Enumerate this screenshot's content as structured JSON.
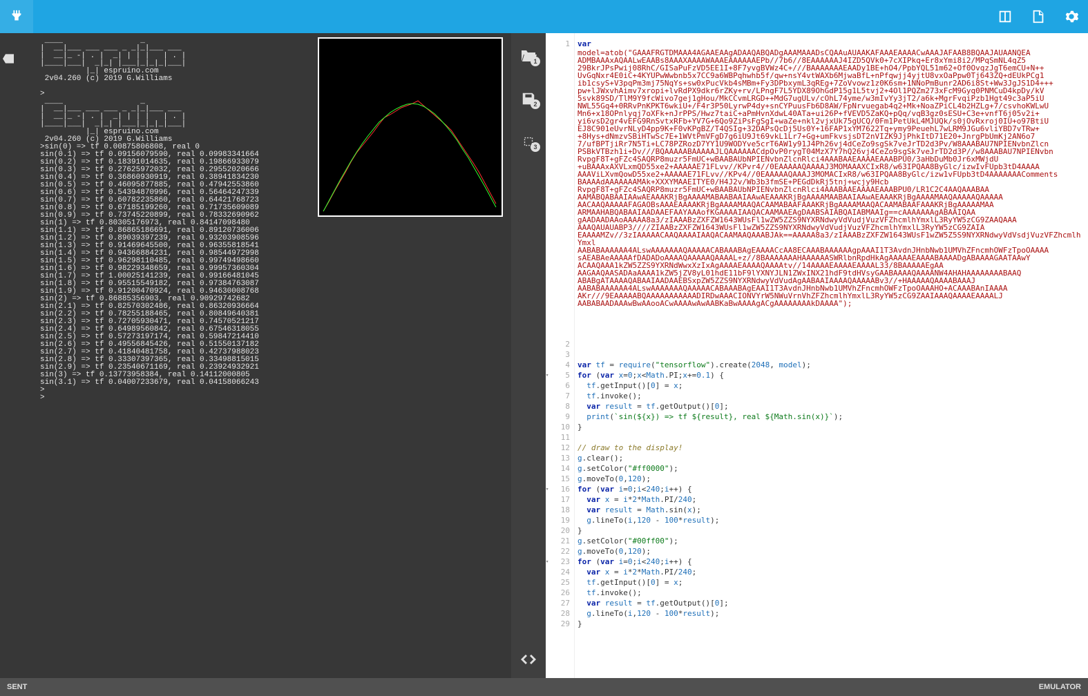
{
  "toolbar": {
    "connect_icon": "plug-icon",
    "layout_icon": "split-icon",
    "book_icon": "book-icon",
    "settings_icon": "gear-icon"
  },
  "left_panel": {
    "close_tab_icon": "close-tab-icon",
    "banner_lines": [
      " ____                 _ ",
      "|  __|___ ___ ___ _ _|_|___ ___ ",
      "|  __|_ -| . |  _| | | |   | . |",
      "|____|___|  _|_| |___|_|_|_|___|",
      "          |_| espruino.com",
      " 2v04.260 (c) 2019 G.Williams",
      "",
      ">",
      " ____                 _ ",
      "|  __|___ ___ ___ _ _|_|___ ___ ",
      "|  __|_ -| . |  _| | | |   | . |",
      "|____|___|  _|_| |___|_|_|_|___|",
      "          |_| espruino.com",
      " 2v04.260 (c) 2019 G.Williams"
    ],
    "output_lines": [
      ">sin(0) => tf 0.00875806808, real 0",
      "sin(0.1) => tf 0.09156079590, real 0.09983341664",
      "sin(0.2) => tf 0.18391014635, real 0.19866933079",
      "sin(0.3) => tf 0.27625972032, real 0.29552020666",
      "sin(0.4) => tf 0.36860930919, real 0.38941834230",
      "sin(0.5) => tf 0.46095877885, real 0.47942553860",
      "sin(0.6) => tf 0.54394870996, real 0.56464247339",
      "sin(0.7) => tf 0.60782235860, real 0.64421768723",
      "sin(0.8) => tf 0.67185199260, real 0.71735609089",
      "sin(0.9) => tf 0.73745220899, real 0.78332690962",
      "sin(1) => tf 0.80305176973, real 0.84147098480",
      "sin(1.1) => tf 0.86865186691, real 0.89120736006",
      "sin(1.2) => tf 0.89039397239, real 0.93203908596",
      "sin(1.3) => tf 0.91469645500, real 0.96355818541",
      "sin(1.4) => tf 0.94366884231, real 0.98544972998",
      "sin(1.5) => tf 0.96298110485, real 0.99749498660",
      "sin(1.6) => tf 0.98229348659, real 0.99957360304",
      "sin(1.7) => tf 1.00025141239, real 0.99166481045",
      "sin(1.8) => tf 0.95515549182, real 0.97384763087",
      "sin(1.9) => tf 0.91200470924, real 0.94630008768",
      "sin(2) => tf 0.86885356903, real 0.90929742682",
      "sin(2.1) => tf 0.82570302486, real 0.86320936664",
      "sin(2.2) => tf 0.78255188465, real 0.80849640381",
      "sin(2.3) => tf 0.72705930471, real 0.74570521217",
      "sin(2.4) => tf 0.64989560842, real 0.67546318055",
      "sin(2.5) => tf 0.57273197174, real 0.59847214410",
      "sin(2.6) => tf 0.49556845426, real 0.51550137182",
      "sin(2.7) => tf 0.41840481758, real 0.42737988023",
      "sin(2.8) => tf 0.33307397365, real 0.33498815015",
      "sin(2.9) => tf 0.23540671169, real 0.23924932921",
      "sin(3) => tf 0.13773958384, real 0.14112000805",
      "sin(3.1) => tf 0.04007233679, real 0.04158066243",
      ">",
      "> "
    ]
  },
  "graph": {
    "series": [
      {
        "name": "tf",
        "color": "#ff3030",
        "points": [
          [
            6,
            250
          ],
          [
            14,
            236
          ],
          [
            22,
            221
          ],
          [
            30,
            207
          ],
          [
            38,
            193
          ],
          [
            46,
            178
          ],
          [
            54,
            165
          ],
          [
            62,
            155
          ],
          [
            70,
            145
          ],
          [
            78,
            135
          ],
          [
            86,
            124
          ],
          [
            94,
            114
          ],
          [
            102,
            110
          ],
          [
            110,
            105
          ],
          [
            118,
            100
          ],
          [
            126,
            97
          ],
          [
            134,
            94
          ],
          [
            142,
            90
          ],
          [
            150,
            97
          ],
          [
            158,
            104
          ],
          [
            166,
            111
          ],
          [
            174,
            118
          ],
          [
            182,
            125
          ],
          [
            190,
            133
          ],
          [
            198,
            145
          ],
          [
            206,
            157
          ],
          [
            214,
            169
          ],
          [
            222,
            181
          ],
          [
            230,
            194
          ],
          [
            238,
            209
          ],
          [
            246,
            224
          ],
          [
            254,
            239
          ]
        ]
      },
      {
        "name": "real",
        "color": "#30ff30",
        "points": [
          [
            6,
            250
          ],
          [
            14,
            235
          ],
          [
            22,
            220
          ],
          [
            30,
            205
          ],
          [
            38,
            191
          ],
          [
            46,
            177
          ],
          [
            54,
            164
          ],
          [
            62,
            152
          ],
          [
            70,
            141
          ],
          [
            78,
            131
          ],
          [
            86,
            121
          ],
          [
            94,
            114
          ],
          [
            102,
            107
          ],
          [
            110,
            102
          ],
          [
            118,
            98
          ],
          [
            126,
            95
          ],
          [
            134,
            94
          ],
          [
            142,
            95
          ],
          [
            150,
            98
          ],
          [
            158,
            103
          ],
          [
            166,
            109
          ],
          [
            174,
            117
          ],
          [
            182,
            126
          ],
          [
            190,
            136
          ],
          [
            198,
            147
          ],
          [
            206,
            160
          ],
          [
            214,
            172
          ],
          [
            222,
            186
          ],
          [
            230,
            200
          ],
          [
            238,
            214
          ],
          [
            246,
            229
          ],
          [
            254,
            244
          ]
        ]
      }
    ]
  },
  "mid": {
    "open": "1",
    "save": "2",
    "chip": "3",
    "code": "code-icon"
  },
  "editor": {
    "lines": [
      {
        "n": 1,
        "t": "kw",
        "c": "var"
      },
      {
        "n": "",
        "t": "b64"
      },
      {
        "n": 2,
        "t": "blank",
        "c": ""
      },
      {
        "n": 3,
        "t": "blank",
        "c": ""
      },
      {
        "n": 4,
        "t": "code",
        "c": "var tf = require(\"tensorflow\").create(2048, model);"
      },
      {
        "n": 5,
        "t": "code",
        "fold": true,
        "c": "for (var x=0;x<Math.PI;x+=0.1) {"
      },
      {
        "n": 6,
        "t": "code",
        "c": "  tf.getInput()[0] = x;"
      },
      {
        "n": 7,
        "t": "code",
        "c": "  tf.invoke();"
      },
      {
        "n": 8,
        "t": "code",
        "c": "  var result = tf.getOutput()[0];"
      },
      {
        "n": 9,
        "t": "code",
        "c": "  print(`sin(${x}) => tf ${result}, real ${Math.sin(x)}`);"
      },
      {
        "n": 10,
        "t": "code",
        "c": "}"
      },
      {
        "n": 11,
        "t": "blank",
        "c": ""
      },
      {
        "n": 12,
        "t": "cmt",
        "c": "// draw to the display!"
      },
      {
        "n": 13,
        "t": "code",
        "c": "g.clear();"
      },
      {
        "n": 14,
        "t": "code",
        "c": "g.setColor(\"#ff0000\");"
      },
      {
        "n": 15,
        "t": "code",
        "c": "g.moveTo(0,120);"
      },
      {
        "n": 16,
        "t": "code",
        "fold": true,
        "c": "for (var i=0;i<240;i++) {"
      },
      {
        "n": 17,
        "t": "code",
        "c": "  var x = i*2*Math.PI/240;"
      },
      {
        "n": 18,
        "t": "code",
        "c": "  var result = Math.sin(x);"
      },
      {
        "n": 19,
        "t": "code",
        "c": "  g.lineTo(i,120 - 100*result);"
      },
      {
        "n": 20,
        "t": "code",
        "c": "}"
      },
      {
        "n": 21,
        "t": "code",
        "c": "g.setColor(\"#00ff00\");"
      },
      {
        "n": 22,
        "t": "code",
        "c": "g.moveTo(0,120);"
      },
      {
        "n": 23,
        "t": "code",
        "fold": true,
        "c": "for (var i=0;i<240;i++) {"
      },
      {
        "n": 24,
        "t": "code",
        "c": "  var x = i*2*Math.PI/240;"
      },
      {
        "n": 25,
        "t": "code",
        "c": "  tf.getInput()[0] = x;"
      },
      {
        "n": 26,
        "t": "code",
        "c": "  tf.invoke();"
      },
      {
        "n": 27,
        "t": "code",
        "c": "  var result = tf.getOutput()[0];"
      },
      {
        "n": 28,
        "t": "code",
        "c": "  g.lineTo(i,120 - 100*result);"
      },
      {
        "n": 29,
        "t": "code",
        "c": "}"
      }
    ],
    "base64": "model=atob(\"GAAAFRGTDMAAA4AGAAEAAgADAAQABQADgAAAMAAADsCQAAuAUAAKAFAAAEAAAACwAAAJAFAAB8BQAAJAUAANQEA\\nADMBAAAxAQAALwEAABs8AAAXAAAAWAAAEAAAAAAEPb//7b6//8EAAAAAAJ4IZD5QVk0+7cXIPkq+Er8xYmi8i2/MPqSmNL4qZ5\\n29BkrJPsPwij08RhC/GISaPuFzVD5EE1I+8F7yvgBVWz4C+///BAAAAAAAEAADy1BE+hO4/PpbYQL51m62+Of0OvqzJgT6emCU+N++\\nUvGqNxr4E0iC+4KYUPwWwbnb5x7CC9a6WBPqhwhb5f/qw+nsY4vtWAXb6MjwaBfL+nPfqwjj4yjtU8vxOaPpw0Tj643ZQ+dEUkPCg1\\nib1csyS+V3pqPm3mj75NqYs+sw0xPucVkb4sMBm+Fy3DPbxymL3qREg+7ZoVvowz1z0K6sm+1NNoPmBunr2AD6i8St+Ww3JgJS1D4+++\\npw+lJWxvhAimv7xropi+lvRdPX9dkr6rZKy+rv/LPngF7L5YDX89OhGdP15g1L5tvj2+4Ol1PQZm273xFcM9Gyq0PNMCuD4kpDy/kV\\n5svk89SD/TlM9Y9fcWivo7gej1gHou/MkCCvmLRGD++MdG7ugULv/cOhL74yme/w3mIvYy3jT2/a6k+MgrFvqiPzb1Hgt49c3aP5iU\\nNWL55Gq4+0RRvPnKPKT6wkiU+/F4r3P50LyrwP4dy+snCYPuusFb6D8AW/FpNrvuegab4q2+Mk+NoaZPiCL4b2HZLg+7/csvhoKWLwU\\nMn6+x18OPnlyqj7oXFk+nJrPPS/Hwz7taiC+aPmHvnXdwL40ATa+ui26P+fVEVD5ZaKQ+pQq/vqB3gz0sESU+C3e+vnfT6j05v2i+\\nyi6vsD2gr4vEFG9RnSvtxRFb+YV7G+6Qo9ZiPsFgSgI+waZe+nkl2vjxUk75gUCQ/0Fm1PetUkL4MJUQk/s0jOvRxroj0IU+o97BtiU\\nEJ8C901eUvrNLyD4pp9K+F0vKPgBZ/T4QSIg+32DAPsQcDj5Us0Y+16FAP1xYM7622Tq+ymy9PeuehL7wLRM9JGu6vliYBD7vTRw+\\n+8Hys+dNmzvSBiHTwSc7E+1WVtPmVFgD7g6iU9Jt69vkL1Lr7+Gg+umFkvsjsDT2nVIZK9JjPhkItD71E20+JnrgPbUmKj2AN6o7\\n7/ufBPTjiRr7N5Ti+LC78PZRozD7YY1U9WODYve5crT6AW1y91J4Ph26vj4dCeZo9sgSk7veJrTD2d3Pv/W8AAABAU7NPIENvbnZlcn\\nPSBkVTBzh1i+Dv///BQAAAAABAAAAAJLQAAAAAACdpOvP0rygT04MzX7Y7hQ26vj4CeZo9sgSk7veJrTD2d3P//w8AAABAU7NPIENvbn\\nRvpgF8T+gFZc4SAQRP8muzr5FmUC+wBAABAUbNPIENvbnZlcnRlci4AAABAAEAAAAEAAABPU0/3aHbDuMb0Jr6xMWjdU\\n+uBAAAxAXVLxmQD55xe2+AAAAAE71FLvv//KPvr4//0EAAAAAQAAAAJ3MOMAAAXCIxR8/w63IPQAA8ByGlc/izwIvFUpb3tD4AAAA\\nAAAViLXvmQowD55xe2+AAAAAE71FLvv//KPv4//0EAAAAAQAAAJ3MOMACIxR8/w63IPQAA8ByGlc/izw1vFUpb3tD4AAAAAAAComments\\nBAAAAdAAAAAAAMAk+XXXYMAAEITYE0/H4J2v/Wb3b3fmSE+PEGdDkRj5tnj+wcjy9Hcb\\nRvpgF8T+gFZc4SAQRP8muzr5FmUC+wBAABAUbNPIENvbnZlcnRlci4AAABAAEAAAAEAAABPU0/LR1C2C4AAQAAABAA\\nAAMABQABAAIAAwAEAAAKRjBgAAAAMABAABAAIAAwAEAAAKRjBgAAAAMAABAAIAAwAEAAAKRjBgAAAAMAAQAAAAAQAAAAA\\nAACAAQAAAAAFAGAOBsAAAEAAAAKRjBgAAAAMAAQACAAMABAAFAAAKRjBgAAAAMAAQACAAMABAAFAAAKRjBgAAAAAMAA\\nARMAAHABQABAAIAADAAEFAAYAAAofKGAAAAIAAQACAAMAAEAgDAABSAIABQAIABMAAIg==cAAAAAAAgABAAIQAA\\ngAADAADAAoAAAAA8a3/zIAAABzZXFZW1643WUsFl1wZW5ZZS9NYXRNdwyVdVudjVuzVFZhcmlhYmxlL3RyYW5zCG9ZAAQAAA\\nAAAQAUAUABP3////ZIAABzZXFZW1643WUsFl1wZW5ZZS9NYXRNdwyVdVudjVuzVFZhcmlhYmxlL3RyYW5zCG9ZAIA\\nEAAAAMZv//3zIAAAAACAAQAAAAIAAQACAAMAAQAAABJAk==AAAAA8a3/zIAAABzZXFZW1643WUsF1wZW5Z5S9NYXRNdwyVdVsdjVuzVFZhcmlhYmxl\\nAABABAAAAAA4ALswAAAAAAAQAAAAACABAAABAgEAAAACcAA8ECAAABAAAAAAgpAAAI1T3AvdnJHnbNwb1UMVhZFncmhOWFzTpoOAAAA\\nsAEABAeAAAAAfDADADoAAAAQAAAAAQAAAAL+z//8BAAAAAAAHAAAAAASWRlbnRpdHkAgAAAAAEAAAABAAAADgABAAAAGAATAAwY\\nACAAQAAA1kZW5ZZS9YXRNdWwxXzIxAgAAAAEAAAAQAAAAtv//14AAAAEAAAAEAAAAL33/8BAAAAAEgAA\\nAAGAAQAASADAaAAAA1kZW5jZV8yL01hdE11bF9lYXNYJLN1ZWxINX21hdF9tdHVsyGAABAAAAQAAAANW4AHAHAAAAAAAABAAQ\\nABABgATAAAAQABAAIAADAAEBSxpZW5ZZS9NYXRNdwyVdVudAgAABAAIAAAAQAAAAABv3//+HAAAAAQAAAABAAAJ\\nAABABAAAAAA4ALswAAAAAAAQAAAAACABAAABAgEAAI1T3AvdnJHnbNwb1UMVhZFncmhOWFzTpoOAAAHO+ACAAABAnIAAAA\\nAKr///9EAAAAABQAAAAAAAAAAADIRDwAAACIONVYrW5NWuVrnVhZFZhcmlhYmxlL3RyYW5zCG9ZAAIAAAQAAAAEAAAALJ\\nAABABAADAAAwBwAAooACwAAAAwAwAABKaBwAAAAgACgAAAAAAAAkDAAAA\");"
  },
  "status": {
    "left": "SENT",
    "right": "EMULATOR"
  }
}
